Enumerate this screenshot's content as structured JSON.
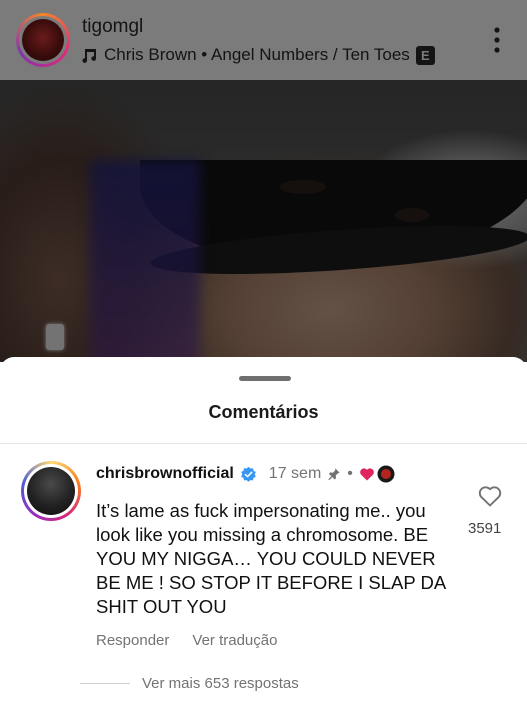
{
  "post": {
    "username": "tigomgl",
    "music": "Chris Brown • Angel Numbers / Ten Toes",
    "explicit_badge": "E"
  },
  "sheet": {
    "title": "Comentários"
  },
  "comment": {
    "username": "chrisbrownofficial",
    "time": "17 sem",
    "separator": "•",
    "text": "It’s lame as fuck impersonating me.. you look like you missing a chromosome. BE YOU MY NIGGA… YOU COULD NEVER BE ME ! SO STOP IT BEFORE I SLAP DA SHIT OUT YOU",
    "like_count": "3591",
    "reply_label": "Responder",
    "translate_label": "Ver tradução",
    "view_replies": "Ver mais 653 respostas"
  },
  "colors": {
    "like_heart": "#e0245e",
    "verified": "#3897f0",
    "muted_text": "#737373"
  },
  "icons": {
    "music": "music-note-icon",
    "more": "more-vertical-icon",
    "verified": "verified-badge-icon",
    "pin": "pin-icon",
    "heart": "heart-outline-icon"
  }
}
